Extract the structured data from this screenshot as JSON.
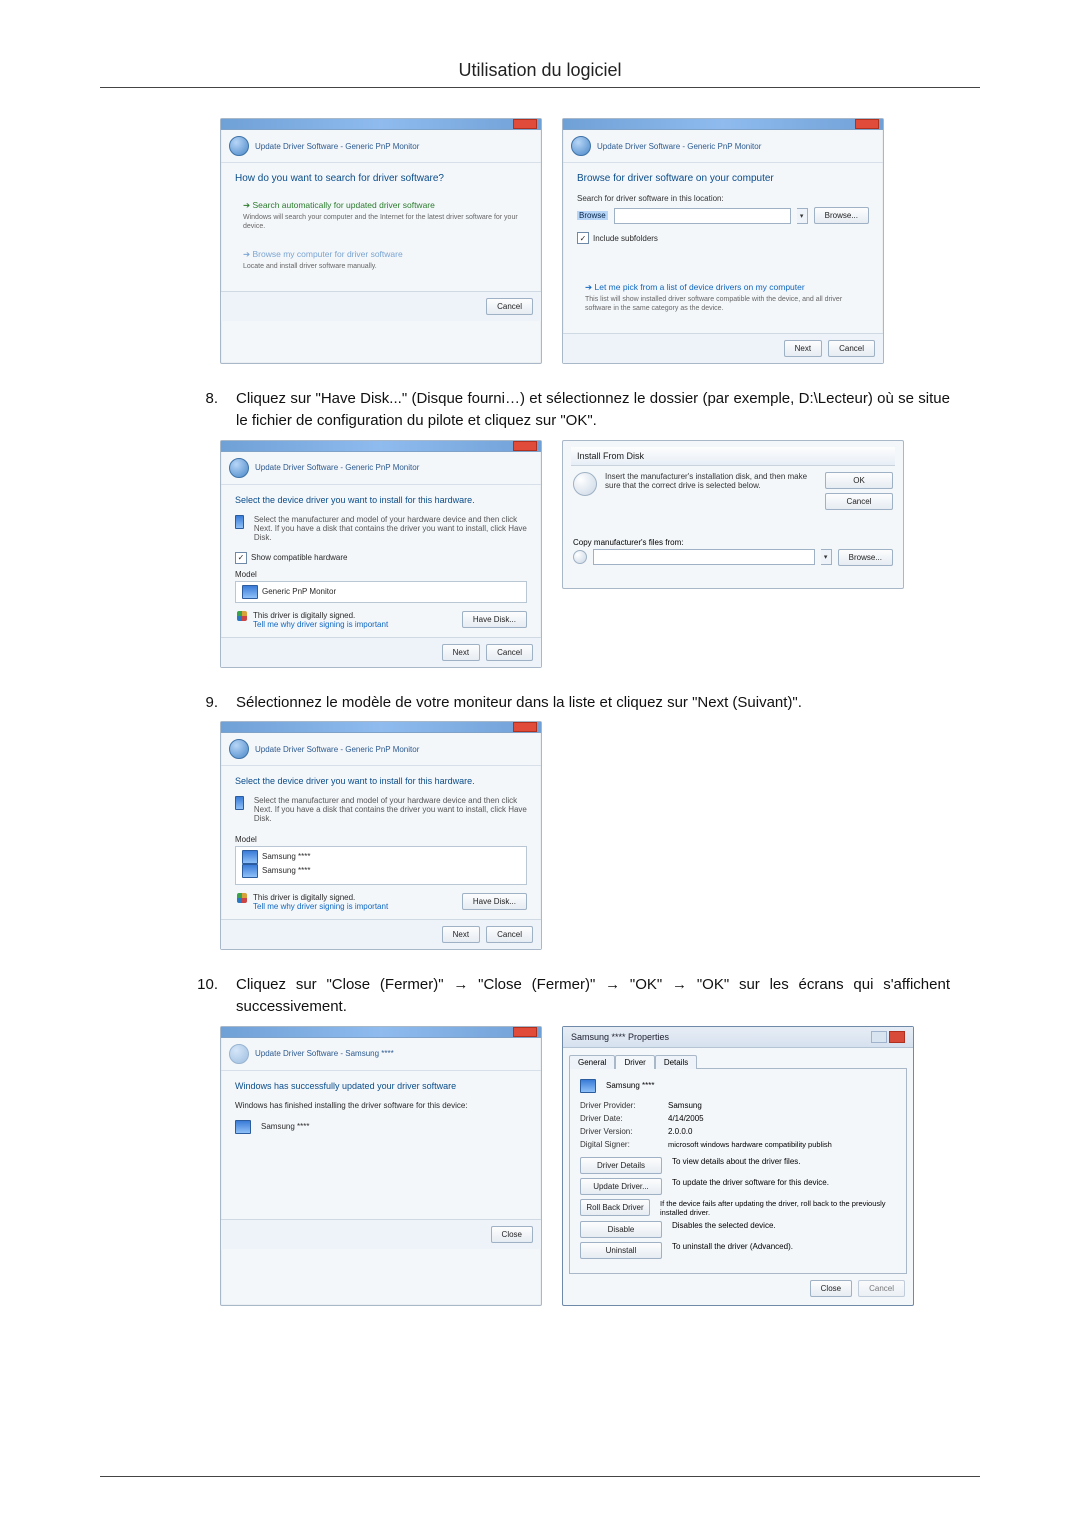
{
  "header": {
    "title": "Utilisation du logiciel"
  },
  "steps": {
    "s8": {
      "num": "8.",
      "text": "Cliquez sur \"Have Disk...\" (Disque fourni…) et sélectionnez le dossier (par exemple, D:\\Lecteur) où se situe le fichier de configuration du pilote et cliquez sur \"OK\"."
    },
    "s9": {
      "num": "9.",
      "text": "Sélectionnez le modèle de votre moniteur dans la liste et cliquez sur \"Next (Suivant)\"."
    },
    "s10": {
      "num": "10.",
      "text": "Cliquez sur \"Close (Fermer)\" → \"Close (Fermer)\" → \"OK\" → \"OK\" sur les écrans qui s'affichent successivement."
    }
  },
  "wiz": {
    "crumb": "Update Driver Software - Generic PnP Monitor",
    "search": {
      "headline": "How do you want to search for driver software?",
      "opt1_lead": "Search automatically for updated driver software",
      "opt1_sub": "Windows will search your computer and the Internet for the latest driver software for your device.",
      "opt2_lead": "Browse my computer for driver software",
      "opt2_sub": "Locate and install driver software manually."
    },
    "browse": {
      "headline": "Browse for driver software on your computer",
      "label": "Search for driver software in this location:",
      "include": "Include subfolders",
      "pick_lead": "Let me pick from a list of device drivers on my computer",
      "pick_sub": "This list will show installed driver software compatible with the device, and all driver software in the same category as the device."
    },
    "select": {
      "headline": "Select the device driver you want to install for this hardware.",
      "instr": "Select the manufacturer and model of your hardware device and then click Next. If you have a disk that contains the driver you want to install, click Have Disk.",
      "show_compat": "Show compatible hardware",
      "model_label": "Model",
      "model_item": "Generic PnP Monitor",
      "signed": "This driver is digitally signed.",
      "why": "Tell me why driver signing is important"
    },
    "select2": {
      "model_a": "Samsung ****",
      "model_b": "Samsung ****"
    },
    "done": {
      "crumb": "Update Driver Software - Samsung ****",
      "headline": "Windows has successfully updated your driver software",
      "sub": "Windows has finished installing the driver software for this device:",
      "device": "Samsung ****"
    },
    "buttons": {
      "cancel": "Cancel",
      "next": "Next",
      "browse": "Browse...",
      "have_disk": "Have Disk...",
      "close": "Close",
      "ok": "OK"
    },
    "path_hilite": "Browse"
  },
  "install_disk": {
    "title": "Install From Disk",
    "msg": "Insert the manufacturer's installation disk, and then make sure that the correct drive is selected below.",
    "copy_label": "Copy manufacturer's files from:",
    "browse": "Browse..."
  },
  "props": {
    "title": "Samsung **** Properties",
    "tabs": {
      "general": "General",
      "driver": "Driver",
      "details": "Details"
    },
    "device": "Samsung ****",
    "rows": {
      "provider_l": "Driver Provider:",
      "provider": "Samsung",
      "date_l": "Driver Date:",
      "date": "4/14/2005",
      "version_l": "Driver Version:",
      "version": "2.0.0.0",
      "signer_l": "Digital Signer:",
      "signer": "microsoft windows hardware compatibility publish"
    },
    "btns": {
      "details": "Driver Details",
      "details_d": "To view details about the driver files.",
      "update": "Update Driver...",
      "update_d": "To update the driver software for this device.",
      "rollback": "Roll Back Driver",
      "rollback_d": "If the device fails after updating the driver, roll back to the previously installed driver.",
      "disable": "Disable",
      "disable_d": "Disables the selected device.",
      "uninstall": "Uninstall",
      "uninstall_d": "To uninstall the driver (Advanced)."
    },
    "close": "Close",
    "cancel": "Cancel"
  }
}
